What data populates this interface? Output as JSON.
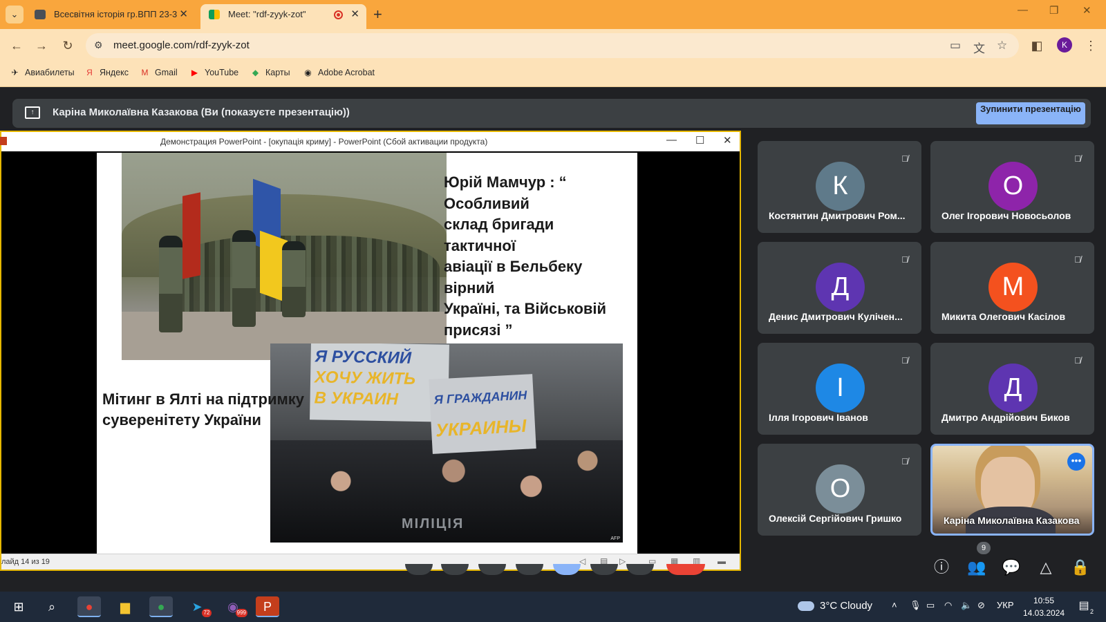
{
  "browser": {
    "tabs": [
      {
        "label": "Всесвітня історія гр.ВПП 23-3",
        "active": false
      },
      {
        "label": "Meet: \"rdf-zyyk-zot\"",
        "active": true,
        "recording": true
      }
    ],
    "url": "meet.google.com/rdf-zyyk-zot",
    "profile_initial": "K",
    "bookmarks": [
      "Авиабилеты",
      "Яндекс",
      "Gmail",
      "YouTube",
      "Карты",
      "Adobe Acrobat"
    ]
  },
  "presenting_bar": {
    "text": "Каріна Миколаївна Казакова (Ви (показуєте презентацію))",
    "stop_button": "Зупинити презентацію"
  },
  "powerpoint": {
    "window_title": "Демонстрация PowerPoint - [окупація криму] - PowerPoint (Сбой активации продукта)",
    "slide_status": "лайд 14 из 19",
    "slide": {
      "quote": "Юрій Мамчур : “\nОсобливий\nсклад  бригади\nтактичної\n авіації в Бельбеку\nвірний\n Україні, та Військовій\nприсязі ”",
      "caption": "Мітинг в Ялті на підтримку суверенітету України",
      "sign1_line1": "Я РУССКИЙ",
      "sign1_line2": "ХОЧУ ЖИТЬ",
      "sign1_line3": "В УКРАИН",
      "sign2_line1": "Я ГРАЖДАНИН",
      "sign2_line2": "УКРАИНЫ",
      "police_text": "МІЛІЦІЯ",
      "photo_credit": "AFP"
    }
  },
  "participants": [
    {
      "name": "Костянтин Дмитрович Ром...",
      "initial": "К",
      "color": "#5f7a8a",
      "muted": true
    },
    {
      "name": "Олег Ігорович Новосьолов",
      "initial": "О",
      "color": "#8e24aa",
      "muted": true
    },
    {
      "name": "Денис Дмитрович Кулічен...",
      "initial": "Д",
      "color": "#5e35b1",
      "muted": true
    },
    {
      "name": "Микита Олегович Касілов",
      "initial": "М",
      "color": "#f4511e",
      "muted": true
    },
    {
      "name": "Ілля Ігорович Іванов",
      "initial": "І",
      "color": "#1e88e5",
      "muted": true
    },
    {
      "name": "Дмитро Андрійович Биков",
      "initial": "Д",
      "color": "#5e35b1",
      "muted": true
    },
    {
      "name": "Олексій Сергійович Гришко",
      "initial": "О",
      "color": "#7b8e99",
      "muted": true
    },
    {
      "name": "Каріна Миколаївна Казакова",
      "initial": "",
      "color": "",
      "muted": false,
      "self": true
    }
  ],
  "meet_controls": {
    "people_count": "9"
  },
  "taskbar": {
    "weather": "3°C  Cloudy",
    "language": "УКР",
    "time": "10:55",
    "date": "14.03.2024",
    "telegram_badge": "72",
    "viber_badge": "999",
    "notifications": "2"
  }
}
